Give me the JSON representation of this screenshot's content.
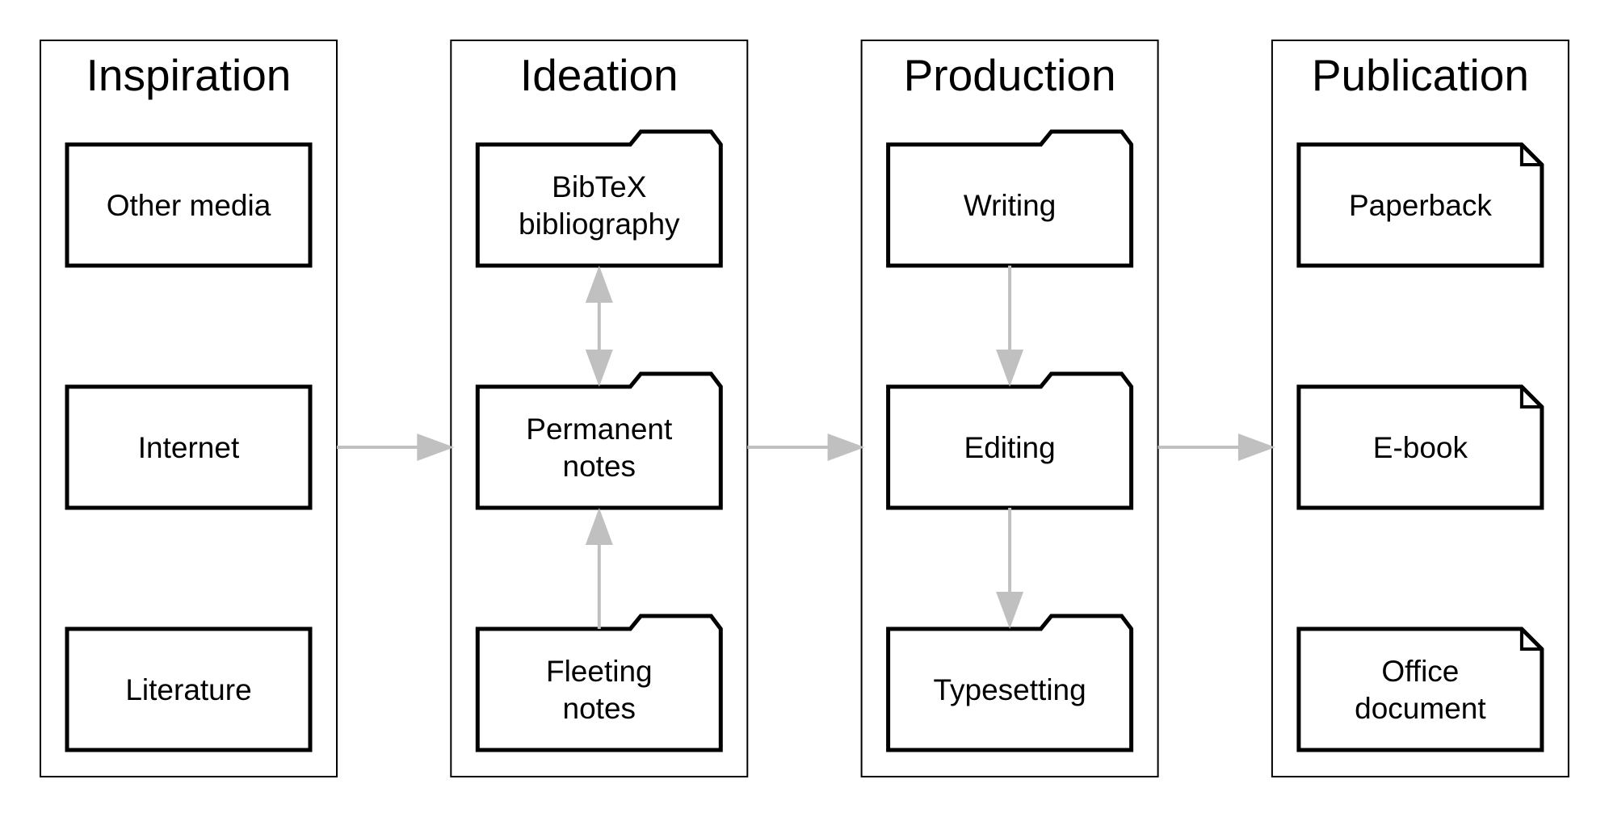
{
  "diagram": {
    "colors": {
      "stroke": "#000000",
      "arrow": "#c0c0c0",
      "background": "#ffffff"
    },
    "columns": [
      {
        "id": "inspiration",
        "title": "Inspiration",
        "shape": "rectangle",
        "nodes": [
          {
            "id": "other-media",
            "lines": [
              "Other media"
            ]
          },
          {
            "id": "internet",
            "lines": [
              "Internet"
            ]
          },
          {
            "id": "literature",
            "lines": [
              "Literature"
            ]
          }
        ]
      },
      {
        "id": "ideation",
        "title": "Ideation",
        "shape": "folder",
        "nodes": [
          {
            "id": "bibtex-bibliography",
            "lines": [
              "BibTeX",
              "bibliography"
            ]
          },
          {
            "id": "permanent-notes",
            "lines": [
              "Permanent",
              "notes"
            ]
          },
          {
            "id": "fleeting-notes",
            "lines": [
              "Fleeting",
              "notes"
            ]
          }
        ]
      },
      {
        "id": "production",
        "title": "Production",
        "shape": "folder",
        "nodes": [
          {
            "id": "writing",
            "lines": [
              "Writing"
            ]
          },
          {
            "id": "editing",
            "lines": [
              "Editing"
            ]
          },
          {
            "id": "typesetting",
            "lines": [
              "Typesetting"
            ]
          }
        ]
      },
      {
        "id": "publication",
        "title": "Publication",
        "shape": "note",
        "nodes": [
          {
            "id": "paperback",
            "lines": [
              "Paperback"
            ]
          },
          {
            "id": "e-book",
            "lines": [
              "E-book"
            ]
          },
          {
            "id": "office-document",
            "lines": [
              "Office",
              "document"
            ]
          }
        ]
      }
    ],
    "edges": [
      {
        "from": "inspiration",
        "to": "ideation",
        "type": "column",
        "direction": "forward"
      },
      {
        "from": "ideation",
        "to": "production",
        "type": "column",
        "direction": "forward"
      },
      {
        "from": "production",
        "to": "publication",
        "type": "column",
        "direction": "forward"
      },
      {
        "from": "bibtex-bibliography",
        "to": "permanent-notes",
        "type": "node",
        "direction": "both"
      },
      {
        "from": "fleeting-notes",
        "to": "permanent-notes",
        "type": "node",
        "direction": "forward"
      },
      {
        "from": "writing",
        "to": "editing",
        "type": "node",
        "direction": "forward"
      },
      {
        "from": "editing",
        "to": "typesetting",
        "type": "node",
        "direction": "forward"
      }
    ]
  }
}
